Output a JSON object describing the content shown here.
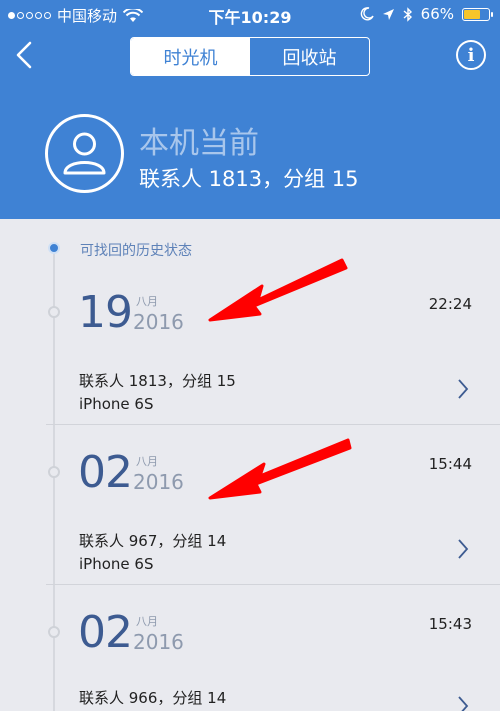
{
  "status_bar": {
    "carrier": "中国移动",
    "time": "下午10:29",
    "battery": "66%",
    "battery_level": 0.66,
    "signal_icon": "signal-dots-icon",
    "wifi_icon": "wifi-icon"
  },
  "nav": {
    "back_icon": "chevron-left-icon",
    "tabs": [
      {
        "label": "时光机",
        "active": true
      },
      {
        "label": "回收站",
        "active": false
      }
    ],
    "info_icon": "info-icon",
    "info_glyph": "i"
  },
  "device": {
    "title": "本机当前",
    "summary": "联系人 1813，分组 15",
    "avatar_icon": "person-avatar-icon"
  },
  "history": {
    "section_label": "可找回的历史状态",
    "entries": [
      {
        "day": "19",
        "month": "八月",
        "year": "2016",
        "time": "22:24",
        "summary": "联系人 1813，分组 15",
        "device": "iPhone 6S"
      },
      {
        "day": "02",
        "month": "八月",
        "year": "2016",
        "time": "15:44",
        "summary": "联系人 967，分组 14",
        "device": "iPhone 6S"
      },
      {
        "day": "02",
        "month": "八月",
        "year": "2016",
        "time": "15:43",
        "summary": "联系人 966，分组 14",
        "device": ""
      }
    ]
  },
  "colors": {
    "header_bg": "#3f82d4",
    "page_bg": "#e9eaef",
    "day_text": "#3d5b91",
    "annotation_arrow": "#ff0000"
  }
}
